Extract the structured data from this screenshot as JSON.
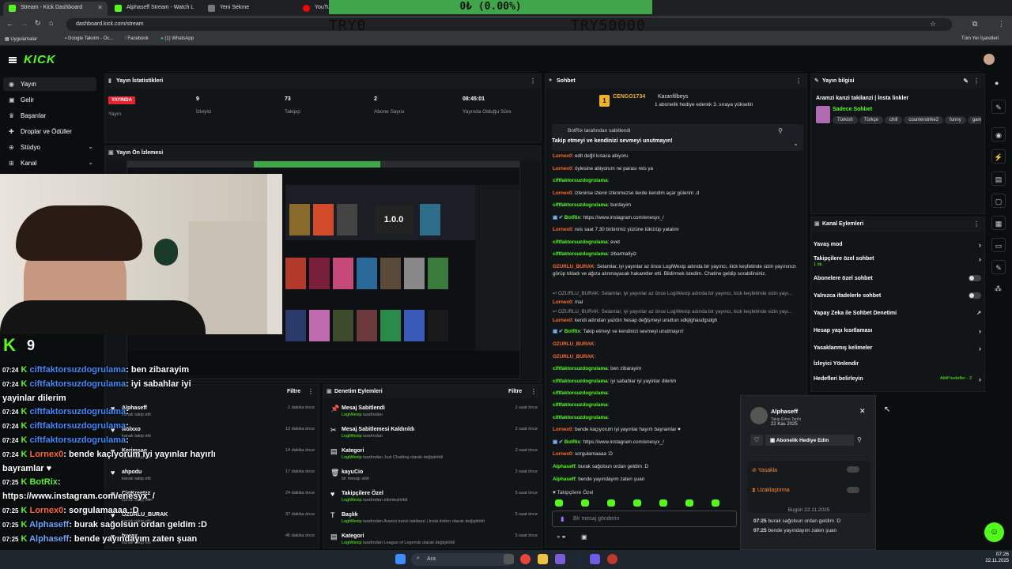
{
  "browser": {
    "tabs": [
      {
        "label": "Stream - Kick Dashboard",
        "color": "#53fc18"
      },
      {
        "label": "Alphaseff Stream - Watch L",
        "color": "#53fc18"
      },
      {
        "label": "Yeni Sekme",
        "color": "#888888"
      },
      {
        "label": "YouTube",
        "color": "#ff0000"
      }
    ],
    "url": "dashboard.kick.com/stream",
    "bookmarks": [
      "Uygulamalar",
      "Google Takvim - Oc...",
      "Facebook",
      "(1) WhatsApp"
    ],
    "bookmarks_right": "Tüm Yer İşaretleri"
  },
  "overlay": {
    "goal_text": "0₺ (0.00%)",
    "try_left": "TRY0",
    "try_right": "TRY50000",
    "follower_count": "9"
  },
  "sidebar": {
    "items": [
      {
        "label": "Yayın",
        "icon": "broadcast-icon"
      },
      {
        "label": "Gelir",
        "icon": "money-icon"
      },
      {
        "label": "Başarılar",
        "icon": "trophy-icon"
      },
      {
        "label": "Droplar ve Ödüller",
        "icon": "gift-icon"
      },
      {
        "label": "Stüdyo",
        "icon": "studio-icon"
      },
      {
        "label": "Kanal",
        "icon": "channel-icon"
      }
    ]
  },
  "stats": {
    "title": "Yayın İstatistikleri",
    "items": [
      {
        "value": "YAYINDA",
        "label": "Yayın"
      },
      {
        "value": "9",
        "label": "İzleyici"
      },
      {
        "value": "73",
        "label": "Takipçi"
      },
      {
        "value": "2",
        "label": "Abone Sayısı"
      },
      {
        "value": "08:45:01",
        "label": "Yayında Olduğu Süre"
      }
    ]
  },
  "preview": {
    "title": "Yayın Ön İzlemesi",
    "version": "1.0.0"
  },
  "overlay_chat": [
    {
      "time": "07:24",
      "user": "ciftfaktorsuzdogrulama",
      "text": ": ben zibarayim",
      "ucolor": "b"
    },
    {
      "time": "07:24",
      "user": "ciftfaktorsuzdogrulama",
      "text": ": iyi sabahlar iyi",
      "ucolor": "b"
    },
    {
      "time": "",
      "user": "",
      "text": "yayinlar dilerim",
      "ucolor": "b"
    },
    {
      "time": "07:24",
      "user": "ciftfaktorsuzdogrulama",
      "text": ":",
      "ucolor": "b"
    },
    {
      "time": "07:24",
      "user": "ciftfaktorsuzdogrulama",
      "text": ":",
      "ucolor": "b"
    },
    {
      "time": "07:24",
      "user": "ciftfaktorsuzdogrulama",
      "text": ":",
      "ucolor": "b"
    },
    {
      "time": "07:24",
      "user": "Lornex0",
      "text": ": bende kaçıyorum iyi yayınlar hayırlı",
      "ucolor": "r"
    },
    {
      "time": "",
      "user": "",
      "text": "bayramlar ♥",
      "ucolor": "r"
    },
    {
      "time": "07:25",
      "user": "BotRix",
      "text": ":",
      "ucolor": "g"
    },
    {
      "time": "",
      "user": "",
      "text": "https://www.instagram.com/enesyx_/",
      "ucolor": "g"
    },
    {
      "time": "07:25",
      "user": "Lornex0",
      "text": ": sorgulamaaaa :D",
      "ucolor": "r"
    },
    {
      "time": "07:25",
      "user": "Alphaseff",
      "text": ": burak sağolsun ordan geldim :D",
      "ucolor": "bl"
    },
    {
      "time": "07:25",
      "user": "Alphaseff",
      "text": ": bende yayındayım zaten şuan",
      "ucolor": "bl"
    }
  ],
  "activity": {
    "title": "Filtre",
    "items": [
      {
        "name": "Alphaseff",
        "sub": "kanalı takip etti",
        "time": "1 dakika önce"
      },
      {
        "name": "wolxxo",
        "sub": "kanalı takip etti",
        "time": "13 dakika önce"
      },
      {
        "name": "Kerimsag",
        "sub": "kanalı takip etti",
        "time": "14 dakika önce"
      },
      {
        "name": "ahpodu",
        "sub": "kanalı takip etti",
        "time": "17 dakika önce"
      },
      {
        "name": "CioKreetzz",
        "sub": "kanalı takip etti",
        "time": "24 dakika önce"
      },
      {
        "name": "OZURLU_BURAK",
        "sub": "kanalı takip etti",
        "time": "37 dakika önce"
      },
      {
        "name": "byeax",
        "sub": "kanalı takip etti",
        "time": "45 dakika önce"
      }
    ]
  },
  "moderation": {
    "title": "Denetim Eylemleri",
    "filter": "Filtre",
    "items": [
      {
        "title": "Mesaj Sabitlendi",
        "actor": "LogiWexip",
        "sub": "tarafından",
        "time": "2 saat önce",
        "icon": "pin-icon"
      },
      {
        "title": "Mesaj Sabitlemesi Kaldırıldı",
        "actor": "LogiWexip",
        "sub": "tarafından",
        "time": "2 saat önce",
        "icon": "unpin-icon"
      },
      {
        "title": "Kategori",
        "actor": "LogiWexip",
        "sub": "tarafından Just Chatting olarak değiştirildi",
        "time": "2 saat önce",
        "icon": "category-icon"
      },
      {
        "title": "kayuCio",
        "actor": "",
        "sub": "bir mesajı sildi",
        "time": "2 saat önce",
        "icon": "delete-icon"
      },
      {
        "title": "Takipçilere Özel",
        "actor": "LogiWexip",
        "sub": "tarafından etkinleştirildi",
        "time": "5 saat önce",
        "icon": "heart-icon"
      },
      {
        "title": "Başlık",
        "actor": "LogiWexip",
        "sub": "tarafından Aramzi kanzi takilanzi | İnsta linkler olarak değiştirildi",
        "time": "5 saat önce",
        "icon": "title-icon"
      },
      {
        "title": "Kategori",
        "actor": "LogiWexip",
        "sub": "tarafından League of Legends olarak değiştirildi",
        "time": "5 saat önce",
        "icon": "category-icon"
      }
    ]
  },
  "chat": {
    "title": "Sohbet",
    "top_user": "CENGO1734",
    "top_user2": "Karanfilbeys",
    "gift_note": "1 abonelik hediye ederek 3. sıraya yükselin",
    "pinned_by": "BotRix tarafından sabitlendi",
    "pinned_text": "Takip etmeyi ve kendinizi sevmeyi unutmayın!",
    "messages": [
      {
        "u": "Lornex0",
        "c": "o",
        "t": ": edit değil kısaca abiyoru"
      },
      {
        "u": "Lornex0",
        "c": "o",
        "t": ": öylesine abiyorum ne parası reis ya"
      },
      {
        "u": "ciftfaktorsuzdogrulama",
        "c": "u",
        "t": ":"
      },
      {
        "u": "Lornex0",
        "c": "o",
        "t": ": izlenirse izlenir izlenmezse ilerde kendim açar gülerim .d"
      },
      {
        "u": "ciftfaktorsuzdogrulama",
        "c": "u",
        "t": ": burdayim"
      },
      {
        "u": "BotRix",
        "c": "bot",
        "t": ": https://www.instagram.com/enesyx_/"
      },
      {
        "u": "Lornex0",
        "c": "o",
        "t": ": reis saat 7.30 birbirimiz yüzüne tükürüp yatalım"
      },
      {
        "u": "ciftfaktorsuzdogrulama",
        "c": "u",
        "t": ": evet"
      },
      {
        "u": "ciftfaktorsuzdogrulama",
        "c": "u",
        "t": ": zibarmaliyiz"
      },
      {
        "u": "OZURLU_BURAK",
        "c": "o",
        "t": ": Selamlar, iyi yayınlar az önce LogiWexip adında bir yayıncı, kick keşfetinde sizin yayınınızı görüp tıkladı ve ağıza alınmayacak hakaretler etti. Bildirmek istedim. Chatine geldip sorabilirsiniz."
      },
      {
        "u": "OZURLU_BURAK",
        "c": "s",
        "t": ": Selamlar, iyi yayınlar az önce LogiWexip adında bir yayıncı, kick keşfetinde sizin yayı..."
      },
      {
        "u": "Lornex0",
        "c": "o",
        "t": ": mal"
      },
      {
        "u": "OZURLU_BURAK",
        "c": "s",
        "t": ": Selamlar, iyi yayınlar az önce LogiWexip adında bir yayıncı, kick keşfetinde sizin yayı..."
      },
      {
        "u": "Lornex0",
        "c": "o",
        "t": ": kendi adından yazdın hesap değişmeyi unuttun sdkjlghasdgsdgh"
      },
      {
        "u": "BotRix",
        "c": "bot",
        "t": ": Takip etmeyi ve kendinizi sevmeyi unutmayın!"
      },
      {
        "u": "OZURLU_BURAK",
        "c": "o",
        "t": ":"
      },
      {
        "u": "OZURLU_BURAK",
        "c": "o",
        "t": ":"
      },
      {
        "u": "ciftfaktorsuzdogrulama",
        "c": "u",
        "t": ": ben zibarayim"
      },
      {
        "u": "ciftfaktorsuzdogrulama",
        "c": "u",
        "t": ": iyi sabahlar iyi yayinlar dilerim"
      },
      {
        "u": "ciftfaktorsuzdogrulama",
        "c": "u",
        "t": ":"
      },
      {
        "u": "ciftfaktorsuzdogrulama",
        "c": "u",
        "t": ":"
      },
      {
        "u": "ciftfaktorsuzdogrulama",
        "c": "u",
        "t": ":"
      },
      {
        "u": "Lornex0",
        "c": "o",
        "t": ": bende kaçıyorum iyi yayınlar hayırlı bayramlar ♥"
      },
      {
        "u": "BotRix",
        "c": "bot",
        "t": ": https://www.instagram.com/enesyx_/"
      },
      {
        "u": "Lornex0",
        "c": "o",
        "t": ": sorgulamaaaa :D"
      },
      {
        "u": "Alphaseff",
        "c": "u",
        "t": ": burak sağolsun ordan geldim :D"
      },
      {
        "u": "Alphaseff",
        "c": "u",
        "t": ": bende yayındayım zaten şuan"
      }
    ],
    "followers_only": "Takipçilere Özel",
    "input_placeholder": "Bir mesaj gönderin"
  },
  "info": {
    "title": "Yayın bilgisi",
    "stream_title": "Aramzi kanzi takilanzi | İnsta linkler",
    "category": "Sadece Sohbet",
    "tags": [
      "Türkish",
      "Türkçe",
      "chill",
      "counterstrike2",
      "funny",
      "gam"
    ]
  },
  "actions": {
    "title": "Kanal Eylemleri",
    "items": [
      {
        "label": "Yavaş mod",
        "type": "arrow",
        "sub": ""
      },
      {
        "label": "Takipçilere özel sohbet",
        "type": "arrow",
        "sub": "1 dk."
      },
      {
        "label": "Abonelere özel sohbet",
        "type": "toggle",
        "sub": ""
      },
      {
        "label": "Yalnızca ifadelerle sohbet",
        "type": "toggle",
        "sub": ""
      },
      {
        "label": "Yapay Zeka ile Sohbet Denetimi",
        "type": "ext",
        "sub": ""
      },
      {
        "label": "Hesap yaşı kısıtlaması",
        "type": "arrow",
        "sub": ""
      },
      {
        "label": "Yasaklanmış kelimeler",
        "type": "arrow",
        "sub": ""
      },
      {
        "label": "İzleyici Yönlendir",
        "type": "none",
        "sub": ""
      },
      {
        "label": "Hedefleri belirleyin",
        "type": "arrow",
        "sub": "Aktif hedefler - 2"
      }
    ]
  },
  "popup": {
    "user": "Alphaseff",
    "follow_label": "Takip Etme Tarihi",
    "follow_date": "22 Kas 2025",
    "gift_button": "Abonelik Hediye Edin",
    "ban": "Yasakla",
    "timeout": "Uzaklaştırma",
    "today": "Bugün 22.11.2025",
    "msgs": [
      {
        "time": "07:25",
        "text": "burak sağolsun ordan geldim :D"
      },
      {
        "time": "07:25",
        "text": "bende yayındayım zaten şuan"
      }
    ]
  },
  "taskbar": {
    "search": "Ara",
    "time": "07:26",
    "date": "22.11.2025"
  }
}
